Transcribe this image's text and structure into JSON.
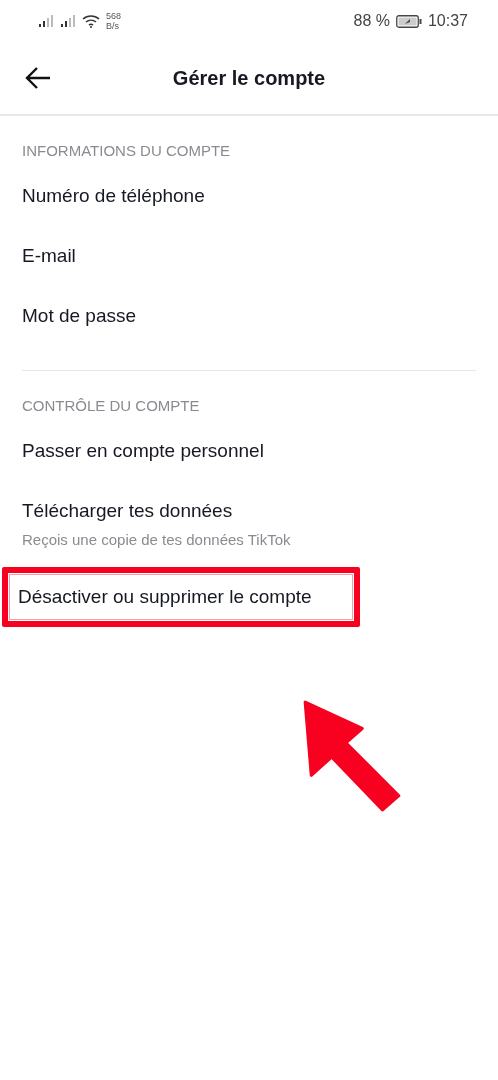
{
  "status_bar": {
    "net_speed": "568",
    "net_unit": "B/s",
    "battery": "88 %",
    "time": "10:37"
  },
  "header": {
    "title": "Gérer le compte"
  },
  "sections": [
    {
      "heading": "INFORMATIONS DU COMPTE",
      "items": [
        {
          "label": "Numéro de téléphone",
          "highlighted": false
        },
        {
          "label": "E-mail",
          "highlighted": false
        },
        {
          "label": "Mot de passe",
          "highlighted": false
        }
      ]
    },
    {
      "heading": "CONTRÔLE DU COMPTE",
      "items": [
        {
          "label": "Passer en compte personnel",
          "highlighted": false
        },
        {
          "label": "Télécharger tes données",
          "subtitle": "Reçois une copie de tes données TikTok",
          "highlighted": false
        },
        {
          "label": "Désactiver ou supprimer le compte",
          "highlighted": true
        }
      ]
    }
  ],
  "annotation": {
    "arrow": true
  }
}
